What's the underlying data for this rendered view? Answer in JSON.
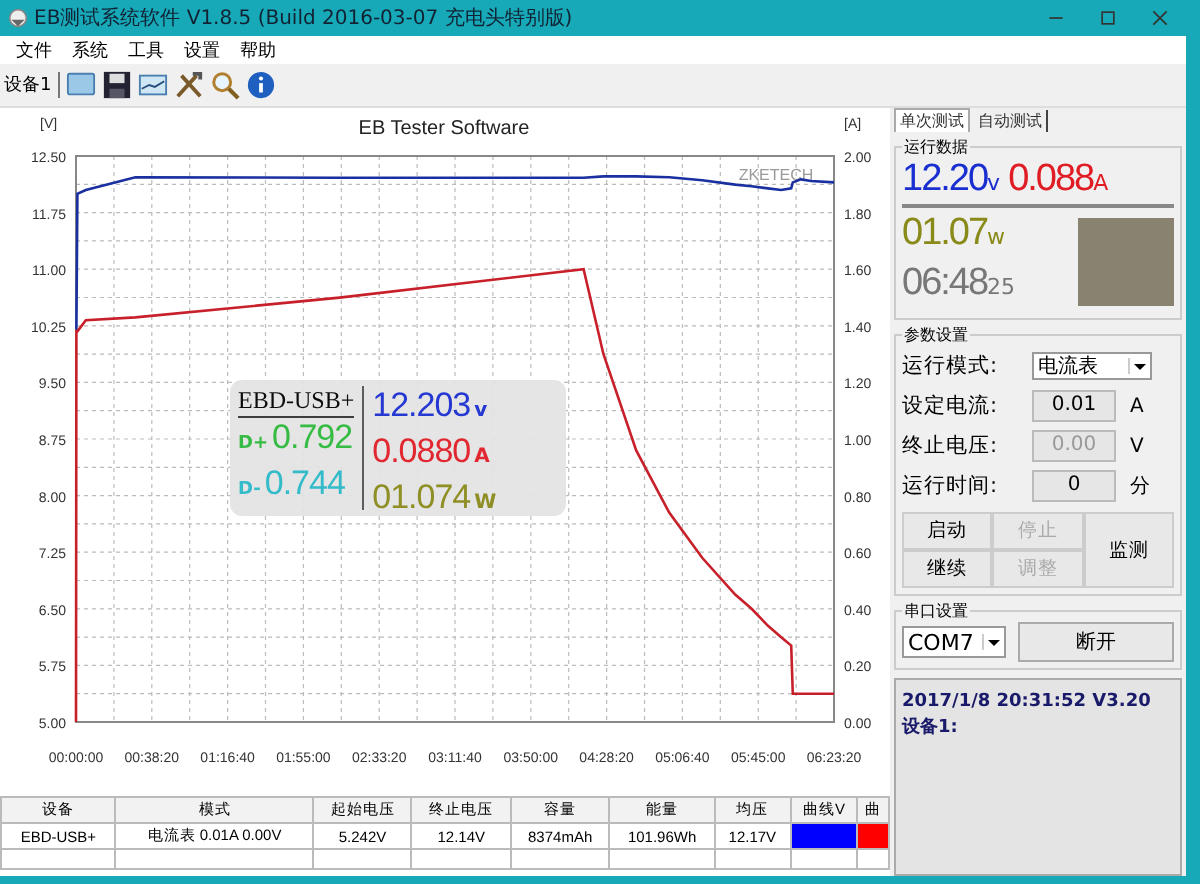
{
  "window": {
    "title": "EB测试系统软件 V1.8.5 (Build 2016-03-07 充电头特别版)"
  },
  "menu": [
    "文件",
    "系统",
    "工具",
    "设置",
    "帮助"
  ],
  "toolbar": {
    "device_label": "设备1"
  },
  "chart": {
    "brand_mark": "ZKETECH",
    "chart_data": {
      "type": "line",
      "title": "EB Tester Software",
      "ylabel": "[V]",
      "y2label": "[A]",
      "x": [
        0,
        10,
        40,
        300,
        1800,
        8000,
        15400,
        16000,
        17000,
        18000,
        19000,
        20000,
        20500,
        21000,
        21400,
        21700,
        21750,
        22000,
        22300,
        23000
      ],
      "series": [
        {
          "color": "#1a2fa0",
          "values": [
            10.2,
            10.2,
            12.0,
            12.05,
            12.22,
            12.21,
            12.21,
            12.23,
            12.23,
            12.22,
            12.18,
            12.12,
            12.1,
            12.07,
            12.05,
            12.07,
            12.15,
            12.19,
            12.17,
            12.15
          ]
        },
        {
          "color": "#c8202a",
          "axis": "y2",
          "values": [
            0,
            1.38,
            1.38,
            1.42,
            1.43,
            1.5,
            1.6,
            1.3,
            0.96,
            0.74,
            0.58,
            0.45,
            0.4,
            0.34,
            0.3,
            0.27,
            0.1,
            0.1,
            0.1,
            0.1
          ]
        }
      ],
      "grid": true,
      "xlim": [
        0,
        23000
      ],
      "ylim": [
        5,
        12.5
      ],
      "y2lim": [
        0,
        2
      ],
      "xticks": [
        {
          "value": 0,
          "label": "00:00:00"
        },
        {
          "value": 2300,
          "label": "00:38:20"
        },
        {
          "value": 4600,
          "label": "01:16:40"
        },
        {
          "value": 6900,
          "label": "01:55:00"
        },
        {
          "value": 9200,
          "label": "02:33:20"
        },
        {
          "value": 11500,
          "label": "03:11:40"
        },
        {
          "value": 13800,
          "label": "03:50:00"
        },
        {
          "value": 16100,
          "label": "04:28:20"
        },
        {
          "value": 18400,
          "label": "05:06:40"
        },
        {
          "value": 20700,
          "label": "05:45:00"
        },
        {
          "value": 23000,
          "label": "06:23:20"
        }
      ],
      "yticks": [
        {
          "value": 5,
          "label": "5.00"
        },
        {
          "value": 5.75,
          "label": "5.75"
        },
        {
          "value": 6.5,
          "label": "6.50"
        },
        {
          "value": 7.25,
          "label": "7.25"
        },
        {
          "value": 8,
          "label": "8.00"
        },
        {
          "value": 8.75,
          "label": "8.75"
        },
        {
          "value": 9.5,
          "label": "9.50"
        },
        {
          "value": 10.25,
          "label": "10.25"
        },
        {
          "value": 11,
          "label": "11.00"
        },
        {
          "value": 11.75,
          "label": "11.75"
        },
        {
          "value": 12.5,
          "label": "12.50"
        }
      ],
      "y2ticks": [
        {
          "value": 0,
          "label": "0.00"
        },
        {
          "value": 0.2,
          "label": "0.20"
        },
        {
          "value": 0.4,
          "label": "0.40"
        },
        {
          "value": 0.6,
          "label": "0.60"
        },
        {
          "value": 0.8,
          "label": "0.80"
        },
        {
          "value": 1,
          "label": "1.00"
        },
        {
          "value": 1.2,
          "label": "1.20"
        },
        {
          "value": 1.4,
          "label": "1.40"
        },
        {
          "value": 1.6,
          "label": "1.60"
        },
        {
          "value": 1.8,
          "label": "1.80"
        },
        {
          "value": 2,
          "label": "2.00"
        }
      ]
    }
  },
  "overlay": {
    "model": "EBD-USB+",
    "dplus_label": "D+",
    "dplus": "0.792",
    "dminus_label": "D-",
    "dminus": "0.744",
    "voltage": "12.203",
    "voltage_unit": "v",
    "current": "0.0880",
    "current_unit": "A",
    "power": "01.074",
    "power_unit": "W"
  },
  "table": {
    "columns": [
      "设备",
      "模式",
      "起始电压",
      "终止电压",
      "容量",
      "能量",
      "均压",
      "曲线V",
      "曲"
    ],
    "rows": [
      {
        "cells": [
          "EBD-USB+",
          "电流表 0.01A 0.00V",
          "5.242V",
          "12.14V",
          "8374mAh",
          "101.96Wh",
          "12.17V"
        ],
        "curves": [
          {
            "color": "#0000ff"
          },
          {
            "color": "#ff0000"
          }
        ]
      }
    ]
  },
  "tabs": [
    {
      "label": "单次测试",
      "selected": true
    },
    {
      "label": "自动测试",
      "selected": false
    }
  ],
  "running_data": {
    "title": "运行数据",
    "voltage": "12.20",
    "voltage_unit": "v",
    "current": "0.088",
    "current_unit": "A",
    "power": "01.07",
    "power_unit": "w",
    "time": "06:48",
    "time_small": "25"
  },
  "params": {
    "title": "参数设置",
    "fields": [
      {
        "label": "运行模式:",
        "kind": "select",
        "value": "电流表"
      },
      {
        "label": "设定电流:",
        "kind": "input",
        "value": "0.01",
        "unit": "A",
        "disabled": false
      },
      {
        "label": "终止电压:",
        "kind": "input",
        "value": "0.00",
        "unit": "V",
        "disabled": true
      },
      {
        "label": "运行时间:",
        "kind": "input",
        "value": "0",
        "unit": "分",
        "disabled": false
      }
    ],
    "buttons": [
      {
        "label": "启动",
        "disabled": false
      },
      {
        "label": "停止",
        "disabled": true
      },
      {
        "label": "监测",
        "disabled": false
      },
      {
        "label": "继续",
        "disabled": false
      },
      {
        "label": "调整",
        "disabled": true
      }
    ]
  },
  "serial": {
    "title": "串口设置",
    "port": "COM7",
    "button": "断开"
  },
  "status": [
    "2017/1/8 20:31:52 V3.20",
    "设备1:"
  ]
}
